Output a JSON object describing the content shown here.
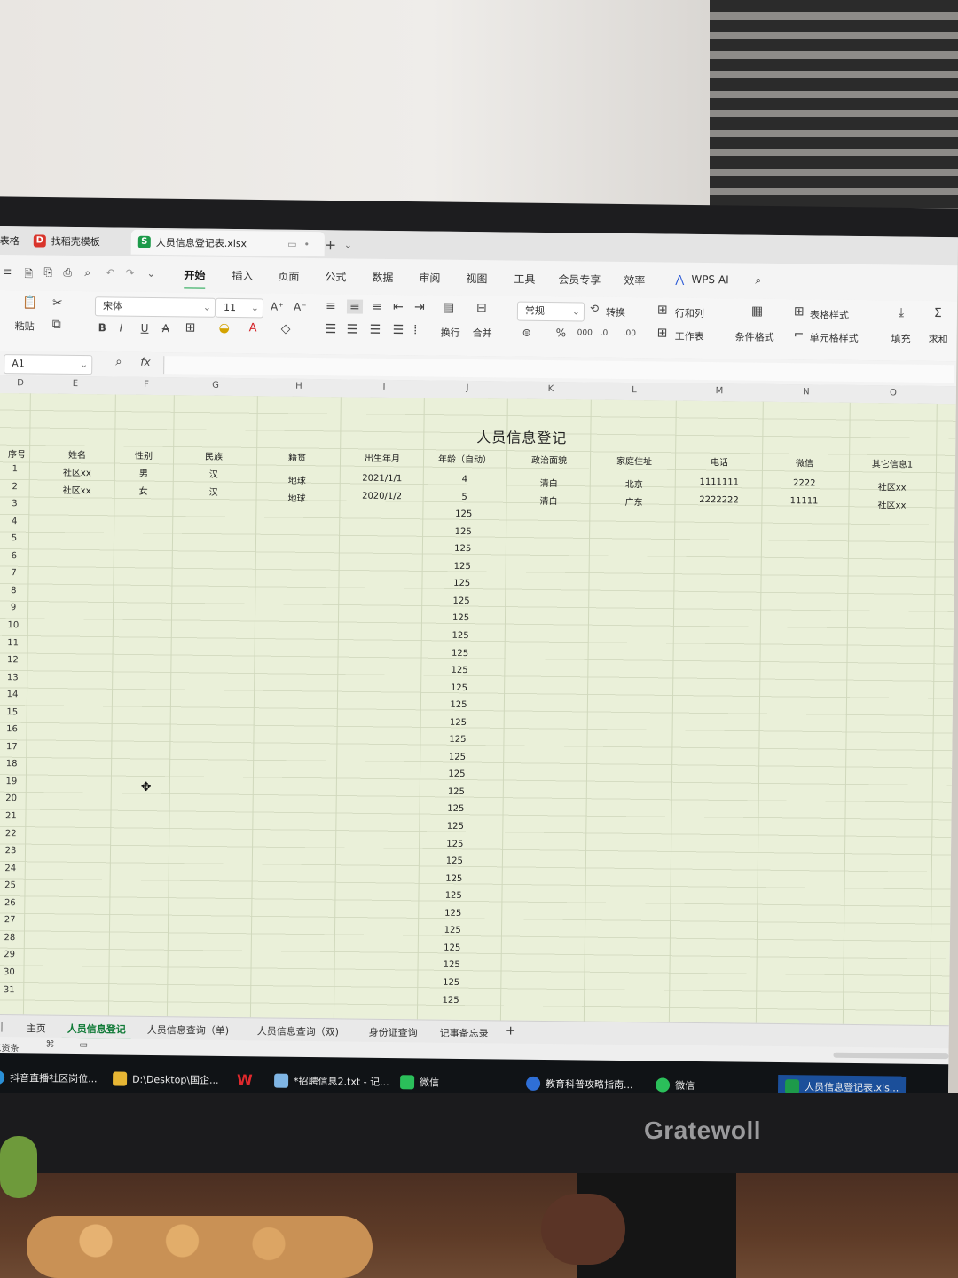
{
  "monitor_brand": "Gratewoll",
  "window_tabs": [
    {
      "label": "找稻壳模板",
      "icon": "wps-logo-icon"
    },
    {
      "label": "人员信息登记表.xlsx",
      "icon": "spreadsheet-icon",
      "active": true
    }
  ],
  "tab_left_fragment": "表格",
  "menu": [
    "开始",
    "插入",
    "页面",
    "公式",
    "数据",
    "审阅",
    "视图",
    "工具",
    "会员专享",
    "效率",
    "WPS AI"
  ],
  "menu_active": "开始",
  "ribbon": {
    "paste": "粘贴",
    "font_name": "宋体",
    "font_size": "11",
    "wrap": "换行",
    "merge": "合并",
    "number_format": "常规",
    "convert": "转换",
    "rows_cols": "行和列",
    "worksheet": "工作表",
    "cond_format": "条件格式",
    "table_style": "表格样式",
    "cell_style": "单元格样式",
    "fill": "填充",
    "sum": "求和"
  },
  "formula_bar": {
    "name_box": "A1",
    "fx": "fx",
    "content": ""
  },
  "columns": [
    "D",
    "E",
    "F",
    "G",
    "H",
    "I",
    "J",
    "K",
    "L",
    "M",
    "N",
    "O"
  ],
  "sheet": {
    "title": "人员信息登记",
    "headers": [
      "序号",
      "姓名",
      "性别",
      "民族",
      "籍贯",
      "出生年月",
      "年龄（自动）",
      "政治面貌",
      "家庭住址",
      "电话",
      "微信",
      "其它信息1"
    ],
    "rows": [
      [
        "1",
        "社区xx",
        "男",
        "汉",
        "地球",
        "2021/1/1",
        "4",
        "清白",
        "北京",
        "1111111",
        "2222",
        "社区xx"
      ],
      [
        "2",
        "社区xx",
        "女",
        "汉",
        "地球",
        "2020/1/2",
        "5",
        "清白",
        "广东",
        "2222222",
        "11111",
        "社区xx"
      ]
    ],
    "row_numbers": [
      "1",
      "2",
      "3",
      "4",
      "5",
      "6",
      "7",
      "8",
      "9",
      "10",
      "11",
      "12",
      "13",
      "14",
      "15",
      "16",
      "17",
      "18",
      "19",
      "20",
      "21",
      "22",
      "23",
      "24",
      "25",
      "26",
      "27",
      "28",
      "29",
      "30",
      "31"
    ],
    "auto_age_empty": "125"
  },
  "sheet_tabs": [
    "主页",
    "人员信息登记",
    "人员信息查询（单)",
    "人员信息查询（双)",
    "身份证查询",
    "记事备忘录"
  ],
  "sheet_tab_active": "人员信息登记",
  "status_left": "工资条",
  "taskbar": [
    {
      "label": "抖音直播社区岗位...",
      "icon": "douyin-icon"
    },
    {
      "label": "D:\\Desktop\\国企...",
      "icon": "folder-icon"
    },
    {
      "label": "",
      "icon": "wps-icon"
    },
    {
      "label": "*招聘信息2.txt - 记...",
      "icon": "notepad-icon"
    },
    {
      "label": "微信",
      "icon": "wechat-window-icon"
    },
    {
      "label": "教育科普攻略指南...",
      "icon": "sogou-icon"
    },
    {
      "label": "微信",
      "icon": "wechat-icon"
    },
    {
      "label": "人员信息登记表.xls...",
      "icon": "spreadsheet-icon",
      "active": true
    }
  ],
  "colors": {
    "sheet_bg": "#eaf0d9",
    "accent": "#17a34a",
    "taskbar": "#101316"
  }
}
